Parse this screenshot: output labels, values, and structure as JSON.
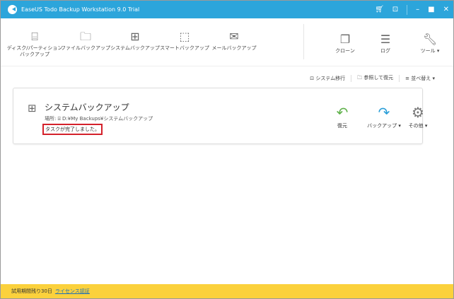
{
  "window": {
    "title": "EaseUS Todo Backup Workstation 9.0 Trial",
    "icons": [
      "cart-icon",
      "activate-icon",
      "minimize-icon",
      "maximize-icon",
      "close-icon"
    ]
  },
  "toolbar": {
    "items": [
      {
        "label": "ディスク/パーティション\nバックアップ",
        "icon": "disk-icon"
      },
      {
        "label": "ファイルバックアップ",
        "icon": "folder-icon"
      },
      {
        "label": "システムバックアップ",
        "icon": "windows-icon"
      },
      {
        "label": "スマートバックアップ",
        "icon": "smart-icon"
      },
      {
        "label": "メールバックアップ",
        "icon": "mail-icon"
      }
    ],
    "right": [
      {
        "label": "クローン",
        "icon": "clone-icon"
      },
      {
        "label": "ログ",
        "icon": "log-icon"
      },
      {
        "label": "ツール ▾",
        "icon": "wrench-icon"
      }
    ]
  },
  "actions": {
    "migrate": "システム移行",
    "browse": "参照して復元",
    "sort": "並べ替え ▾"
  },
  "task": {
    "title": "システムバックアップ",
    "location_label": "場所:",
    "location": "D:¥My Backups¥システムバックアップ",
    "status": "タスクが完了しました。",
    "restore": "復元",
    "backup": "バックアップ ▾",
    "more": "その他 ▾"
  },
  "footer": {
    "trial": "試用期間残り30日",
    "license": "ライセンス認証"
  }
}
